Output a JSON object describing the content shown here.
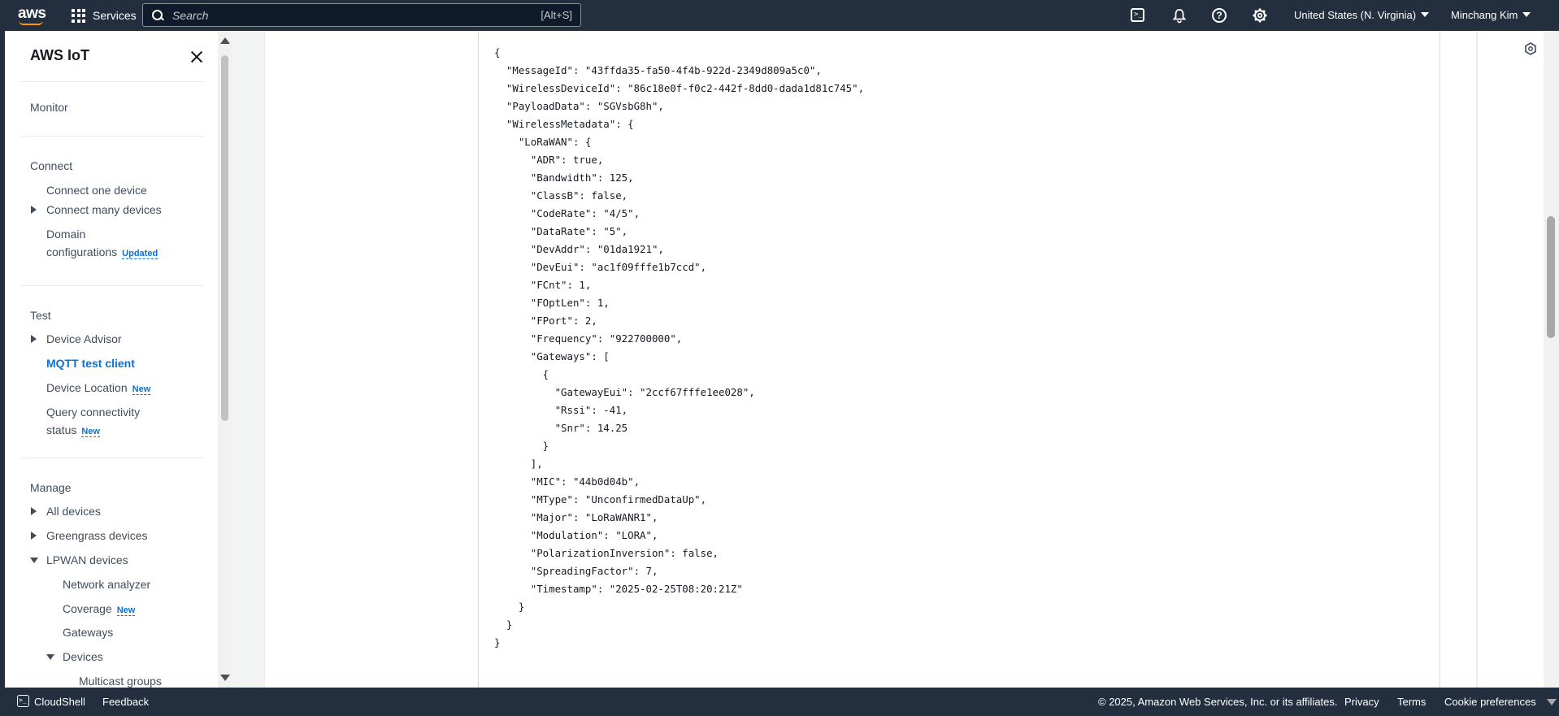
{
  "topnav": {
    "logo_text": "aws",
    "services_label": "Services",
    "search_placeholder": "Search",
    "search_shortcut": "[Alt+S]",
    "region_label": "United States (N. Virginia)",
    "user_label": "Minchang Kim",
    "icons": [
      "cloudshell-icon",
      "bell-icon",
      "help-icon",
      "gear-icon"
    ]
  },
  "sidebar": {
    "title": "AWS IoT",
    "monitor": "Monitor",
    "connect": {
      "heading": "Connect",
      "items": [
        "Connect one device",
        "Connect many devices"
      ],
      "domain_line1": "Domain",
      "domain_line2": "configurations",
      "domain_badge": "Updated"
    },
    "test": {
      "heading": "Test",
      "device_advisor": "Device Advisor",
      "mqtt": "MQTT test client",
      "device_location": "Device Location",
      "device_location_badge": "New",
      "query_line1": "Query connectivity",
      "query_line2": "status",
      "query_badge": "New"
    },
    "manage": {
      "heading": "Manage",
      "all_devices": "All devices",
      "greengrass": "Greengrass devices",
      "lpwan": "LPWAN devices",
      "network_analyzer": "Network analyzer",
      "coverage": "Coverage",
      "coverage_badge": "New",
      "gateways": "Gateways",
      "devices": "Devices",
      "multicast": "Multicast groups"
    }
  },
  "payload": {
    "MessageId": "43ffda35-fa50-4f4b-922d-2349d809a5c0",
    "WirelessDeviceId": "86c18e0f-f0c2-442f-8dd0-dada1d81c745",
    "PayloadData": "SGVsbG8h",
    "WirelessMetadata": {
      "LoRaWAN": {
        "ADR": true,
        "Bandwidth": 125,
        "ClassB": false,
        "CodeRate": "4/5",
        "DataRate": "5",
        "DevAddr": "01da1921",
        "DevEui": "ac1f09fffe1b7ccd",
        "FCnt": 1,
        "FOptLen": 1,
        "FPort": 2,
        "Frequency": "922700000",
        "Gateways": [
          {
            "GatewayEui": "2ccf67fffe1ee028",
            "Rssi": -41,
            "Snr": 14.25
          }
        ],
        "MIC": "44b0d04b",
        "MType": "UnconfirmedDataUp",
        "Major": "LoRaWANR1",
        "Modulation": "LORA",
        "PolarizationInversion": false,
        "SpreadingFactor": 7,
        "Timestamp": "2025-02-25T08:20:21Z"
      }
    }
  },
  "footer": {
    "cloudshell": "CloudShell",
    "feedback": "Feedback",
    "copyright": "© 2025, Amazon Web Services, Inc. or its affiliates.",
    "privacy": "Privacy",
    "terms": "Terms",
    "cookies": "Cookie preferences"
  }
}
